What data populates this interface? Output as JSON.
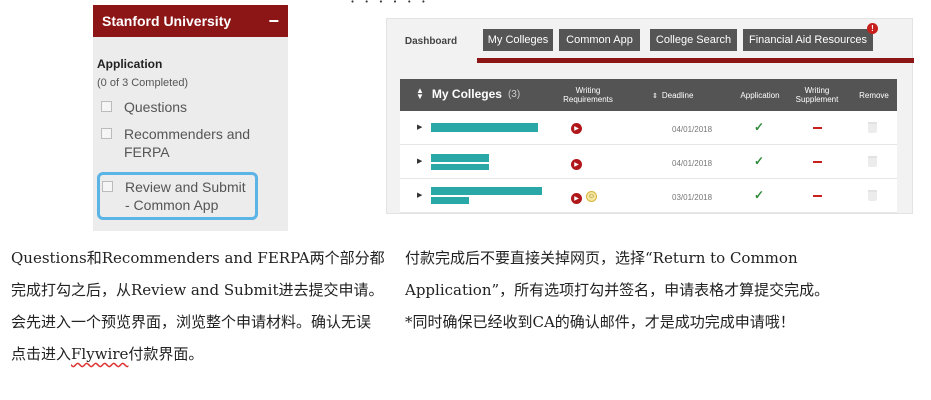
{
  "left_panel": {
    "school": "Stanford University",
    "collapse_symbol": "−",
    "section": "Application",
    "progress": "(0 of 3 Completed)",
    "items": [
      {
        "label": "Questions",
        "checked": false
      },
      {
        "label": "Recommenders and FERPA",
        "checked": false
      },
      {
        "label": "Review and Submit - Common App",
        "checked": false,
        "highlighted": true
      }
    ]
  },
  "right_panel": {
    "tabs": [
      {
        "label": "Dashboard",
        "active": true
      },
      {
        "label": "My Colleges"
      },
      {
        "label": "Common App"
      },
      {
        "label": "College Search"
      },
      {
        "label": "Financial Aid Resources"
      }
    ],
    "alert_badge": "!",
    "table": {
      "title": "My Colleges",
      "count": "(3)",
      "columns": [
        "Writing Requirements",
        "Deadline",
        "Application",
        "Writing Supplement",
        "Remove"
      ],
      "rows": [
        {
          "deadline": "04/01/2018",
          "application": "✓",
          "supplement": "–"
        },
        {
          "deadline": "04/01/2018",
          "application": "✓",
          "supplement": "–"
        },
        {
          "deadline": "03/01/2018",
          "application": "✓",
          "supplement": "–"
        }
      ]
    }
  },
  "captions": {
    "left": "Questions和Recommenders and FERPA两个部分都完成打勾之后，从Review and Submit进去提交申请。会先进入一个预览界面，浏览整个申请材料。确认无误点击进入Flywire付款界面。",
    "left_part1": "Questions和Recommenders and FERPA两个部分都完成打勾之后，从Review and Submit进去提交申请。会先进入一个预览界面，浏览整个申请材料。确认无误点击进入",
    "left_part2": "Flywire",
    "left_part3": "付款界面。",
    "right_line1": "付款完成后不要直接关掉网页，选择“Return to Common",
    "right_line2": "Application”，所有选项打勾并签名，申请表格才算提交完成。",
    "right_line3": "*同时确保已经收到CA的确认邮件，才是成功完成申请哦！"
  },
  "colors": {
    "stanford_red": "#8c1515",
    "tab_dark": "#555555",
    "highlight_blue": "#5ab4e6",
    "teal_bar": "#2aa8a8",
    "check_green": "#2e8b3a"
  }
}
